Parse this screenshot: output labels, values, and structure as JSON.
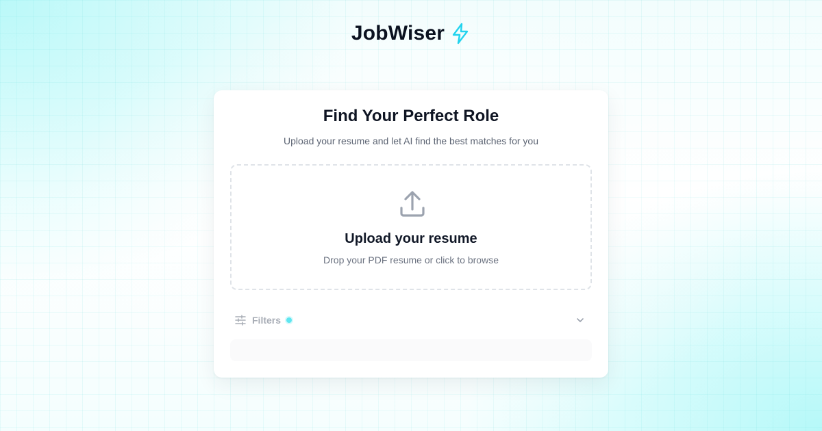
{
  "brand": {
    "name": "JobWiser",
    "icon": "lightning-bolt-icon",
    "accent_color": "#22d3ee"
  },
  "card": {
    "title": "Find Your Perfect Role",
    "subtitle": "Upload your resume and let AI find the best matches for you"
  },
  "upload": {
    "icon": "upload-icon",
    "title": "Upload your resume",
    "subtitle": "Drop your PDF resume or click to browse"
  },
  "filters": {
    "label": "Filters",
    "icon": "sliders-icon",
    "indicator_color": "#5fe6f0",
    "expand_icon": "chevron-down-icon"
  }
}
